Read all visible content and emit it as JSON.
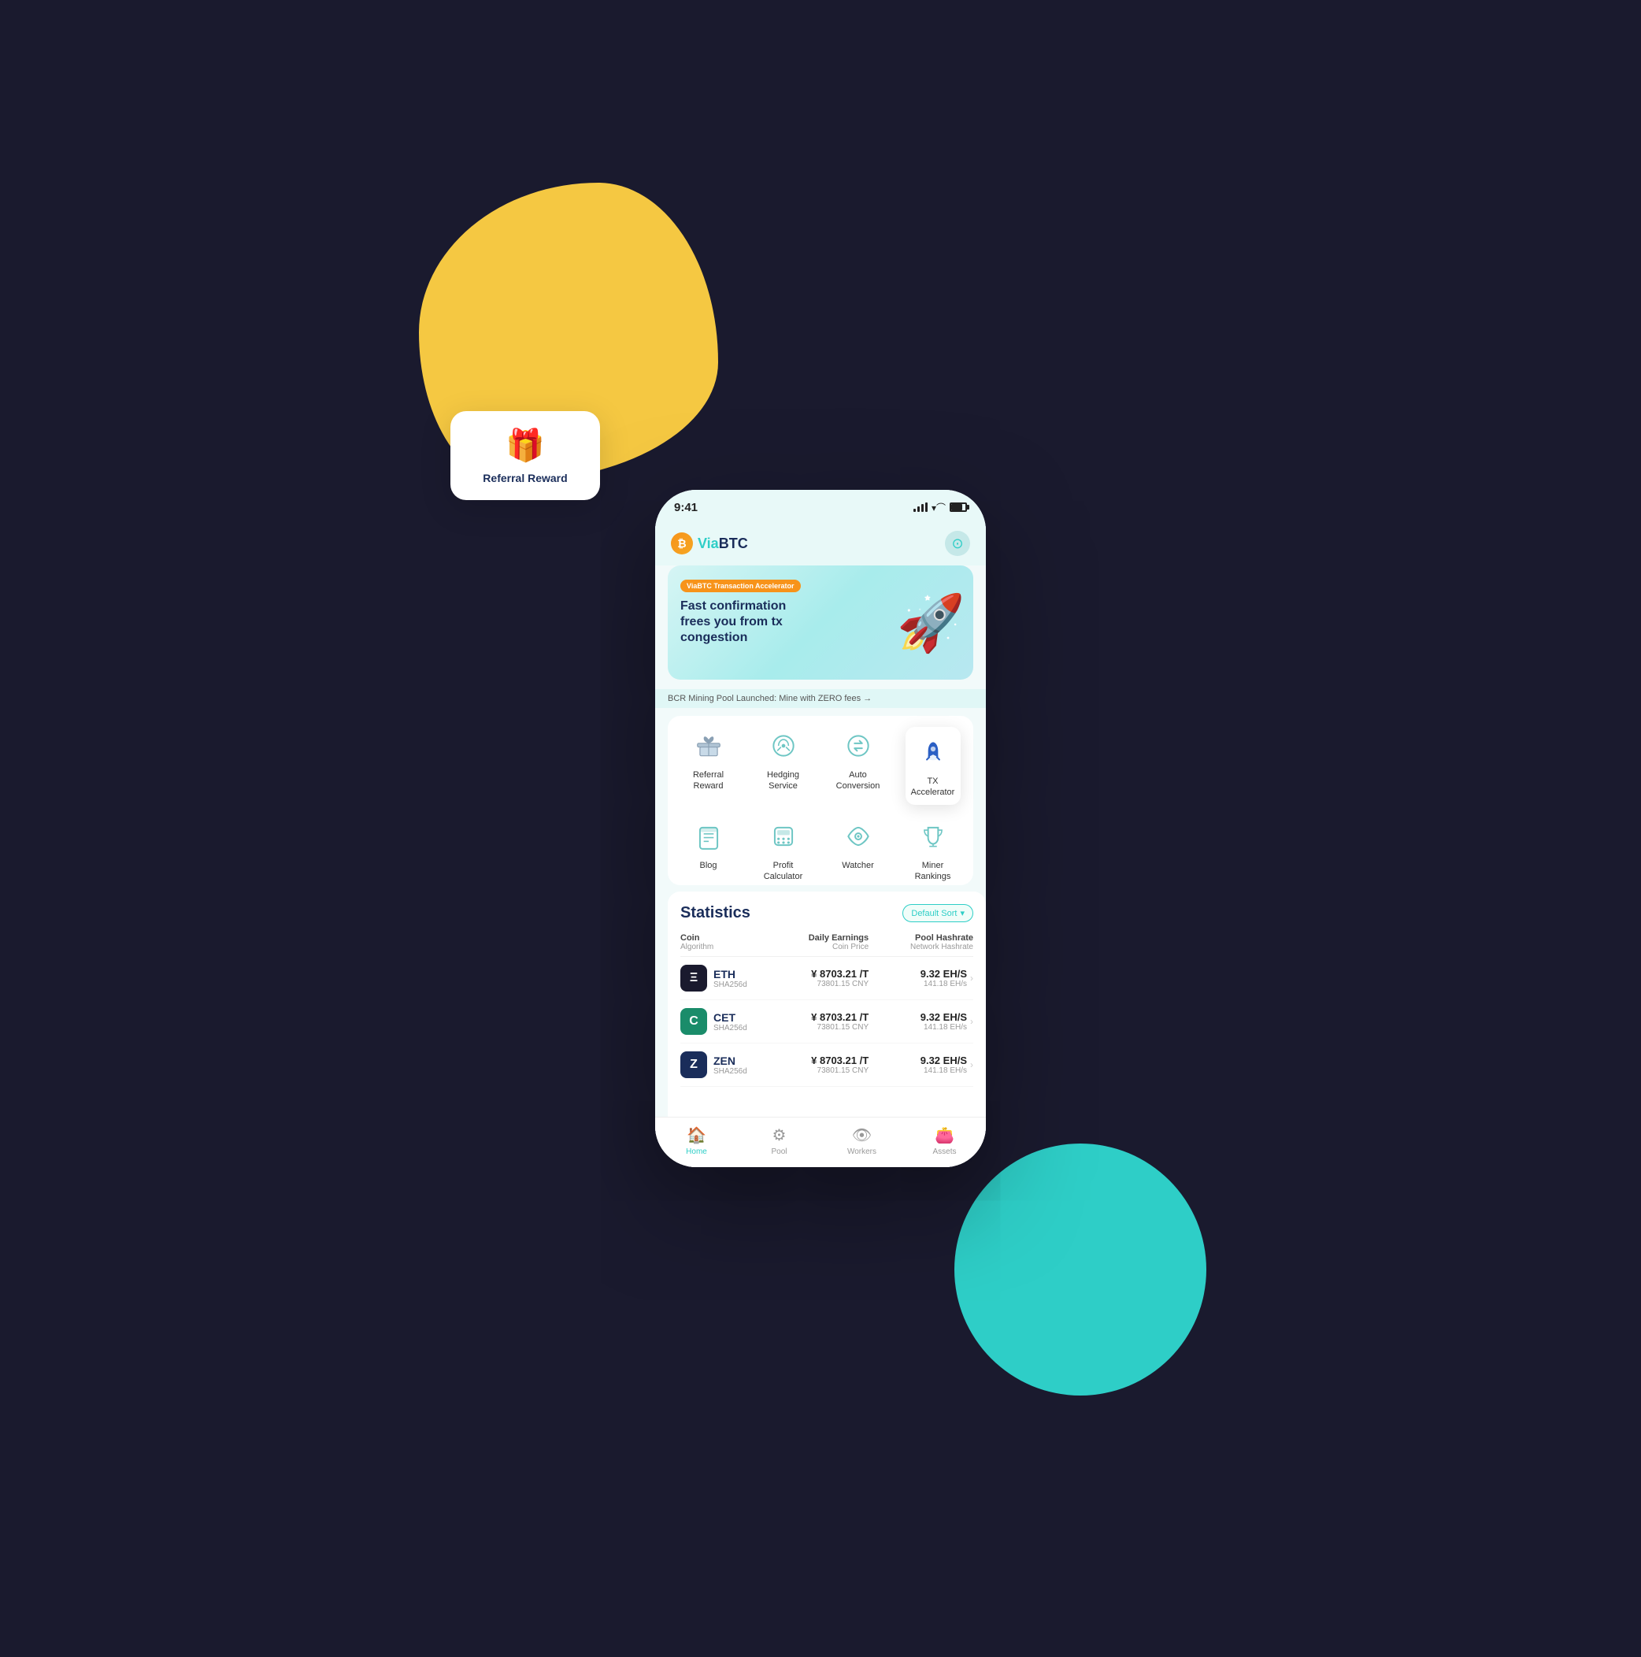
{
  "scene": {
    "status": {
      "time": "9:41"
    },
    "header": {
      "logo_symbol": "₿",
      "logo_via": "Via",
      "logo_btc": "BTC",
      "avatar_icon": "👤"
    },
    "banner": {
      "tag": "ViaBTC Transaction Accelerator",
      "title": "Fast confirmation frees you from tx congestion",
      "rocket_emoji": "🚀"
    },
    "marquee": "BCR Mining Pool Launched: Mine with ZERO fees →",
    "services_row1": [
      {
        "id": "referral",
        "label": "Referral\nReward",
        "icon": "gift"
      },
      {
        "id": "hedging",
        "label": "Hedging\nService",
        "icon": "hedging"
      },
      {
        "id": "auto-conversion",
        "label": "Auto\nConversion",
        "icon": "conversion"
      },
      {
        "id": "tx-accelerator",
        "label": "TX\nAccelerator",
        "icon": "rocket",
        "highlighted": true
      }
    ],
    "services_row2": [
      {
        "id": "blog",
        "label": "Blog",
        "icon": "blog"
      },
      {
        "id": "profit-calculator",
        "label": "Profit\nCalculator",
        "icon": "calculator"
      },
      {
        "id": "watcher",
        "label": "Watcher",
        "icon": "eye"
      },
      {
        "id": "miner-rankings",
        "label": "Miner\nRankings",
        "icon": "trophy"
      }
    ],
    "statistics": {
      "title": "Statistics",
      "sort_label": "Default Sort",
      "sort_icon": "▾",
      "columns": {
        "coin": "Coin",
        "coin_sub": "Algorithm",
        "earnings": "Daily Earnings",
        "earnings_sub": "Coin Price",
        "hashrate": "Pool Hashrate",
        "hashrate_sub": "Network Hashrate"
      },
      "coins": [
        {
          "name": "ETH",
          "algo": "SHA256d",
          "logo": "Ξ",
          "logo_bg": "eth",
          "earnings": "¥ 8703.21 /T",
          "earnings_sub": "73801.15 CNY",
          "hashrate": "9.32 EH/S",
          "hashrate_sub": "141.18 EH/s"
        },
        {
          "name": "CET",
          "algo": "SHA256d",
          "logo": "C",
          "logo_bg": "cet",
          "earnings": "¥ 8703.21 /T",
          "earnings_sub": "73801.15 CNY",
          "hashrate": "9.32 EH/S",
          "hashrate_sub": "141.18 EH/s"
        },
        {
          "name": "ZEN",
          "algo": "SHA256d",
          "logo": "Z",
          "logo_bg": "zen",
          "earnings": "¥ 8703.21 /T",
          "earnings_sub": "73801.15 CNY",
          "hashrate": "9.32 EH/S",
          "hashrate_sub": "141.18 EH/s"
        }
      ]
    },
    "bottom_nav": [
      {
        "id": "home",
        "label": "Home",
        "icon": "🏠",
        "active": true
      },
      {
        "id": "pool",
        "label": "Pool",
        "icon": "⚙",
        "active": false
      },
      {
        "id": "workers",
        "label": "Workers",
        "icon": "👁",
        "active": false
      },
      {
        "id": "assets",
        "label": "Assets",
        "icon": "👛",
        "active": false
      }
    ],
    "referral_card": {
      "icon": "🎁",
      "label": "Referral Reward"
    }
  }
}
